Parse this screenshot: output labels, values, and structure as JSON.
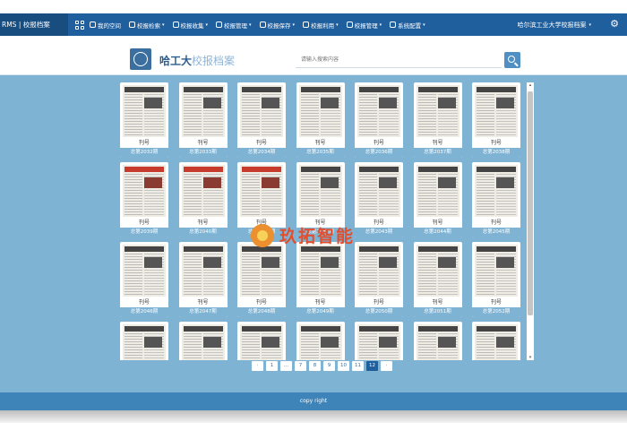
{
  "topbar": {
    "brand": "RMS | 校报档案",
    "nav": [
      {
        "label": "我的空间",
        "caret": false
      },
      {
        "label": "校报检索",
        "caret": true
      },
      {
        "label": "校报收集",
        "caret": true
      },
      {
        "label": "校报管理",
        "caret": true
      },
      {
        "label": "校报保存",
        "caret": true
      },
      {
        "label": "校报利用",
        "caret": true
      },
      {
        "label": "校报管理",
        "caret": true
      },
      {
        "label": "系统配置",
        "caret": true
      }
    ],
    "university": "哈尔滨工业大学校报档案",
    "caret_glyph": "▾",
    "gear_glyph": "⚙"
  },
  "header": {
    "site_title_main": "哈工大",
    "site_title_accent": "校报档案",
    "search_placeholder": "请输入搜索内容"
  },
  "cards": [
    {
      "title": "刊号",
      "issue": "总第2032期",
      "style": "normal"
    },
    {
      "title": "刊号",
      "issue": "总第2033期",
      "style": "normal"
    },
    {
      "title": "刊号",
      "issue": "总第2034期",
      "style": "normal"
    },
    {
      "title": "刊号",
      "issue": "总第2035期",
      "style": "normal"
    },
    {
      "title": "刊号",
      "issue": "总第2036期",
      "style": "normal"
    },
    {
      "title": "刊号",
      "issue": "总第2037期",
      "style": "normal"
    },
    {
      "title": "刊号",
      "issue": "总第2038期",
      "style": "normal"
    },
    {
      "title": "刊号",
      "issue": "总第2039期",
      "style": "red"
    },
    {
      "title": "刊号",
      "issue": "总第2040期",
      "style": "red"
    },
    {
      "title": "刊号",
      "issue": "总第2041期",
      "style": "red"
    },
    {
      "title": "刊号",
      "issue": "总第2042期",
      "style": "normal"
    },
    {
      "title": "刊号",
      "issue": "总第2043期",
      "style": "normal"
    },
    {
      "title": "刊号",
      "issue": "总第2044期",
      "style": "normal"
    },
    {
      "title": "刊号",
      "issue": "总第2045期",
      "style": "normal"
    },
    {
      "title": "刊号",
      "issue": "总第2046期",
      "style": "normal"
    },
    {
      "title": "刊号",
      "issue": "总第2047期",
      "style": "normal"
    },
    {
      "title": "刊号",
      "issue": "总第2048期",
      "style": "normal"
    },
    {
      "title": "刊号",
      "issue": "总第2049期",
      "style": "normal"
    },
    {
      "title": "刊号",
      "issue": "总第2050期",
      "style": "normal"
    },
    {
      "title": "刊号",
      "issue": "总第2051期",
      "style": "normal"
    },
    {
      "title": "刊号",
      "issue": "总第2052期",
      "style": "normal"
    },
    {
      "title": "",
      "issue": "",
      "style": "normal"
    },
    {
      "title": "",
      "issue": "",
      "style": "normal"
    },
    {
      "title": "",
      "issue": "",
      "style": "normal"
    },
    {
      "title": "",
      "issue": "",
      "style": "normal"
    },
    {
      "title": "",
      "issue": "",
      "style": "normal"
    },
    {
      "title": "",
      "issue": "",
      "style": "normal"
    },
    {
      "title": "",
      "issue": "",
      "style": "normal"
    }
  ],
  "pagination": {
    "prev": "‹",
    "pages": [
      "1",
      "...",
      "7",
      "8",
      "9",
      "10",
      "11",
      "12"
    ],
    "active": "12",
    "next": "›"
  },
  "watermark": {
    "text": "玖拓智能"
  },
  "footer": {
    "text": "copy right"
  },
  "colors": {
    "nav_bg": "#1f5f9e",
    "panel_bg": "#7fb3d3",
    "footer_bg": "#3e84b8",
    "active_page": "#1f5f9e"
  }
}
